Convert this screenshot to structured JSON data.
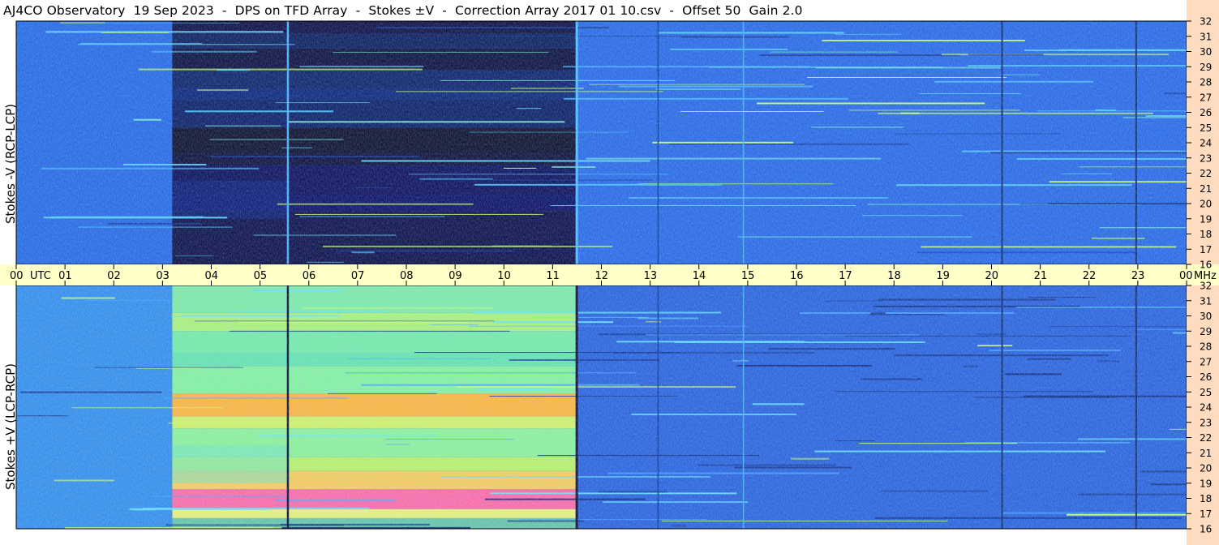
{
  "title": "AJ4CO Observatory  19 Sep 2023  -  DPS on TFD Array  -  Stokes ±V  -  Correction Array 2017 01 10.csv  -  Offset 50  Gain 2.0",
  "colors": {
    "axis_band": "#ffffc8",
    "freq_band": "#ffdcc0",
    "bg": "#ffffff"
  },
  "chart_data": [
    {
      "type": "heatmap",
      "panel": "top",
      "ylabel": "Stokes -V (RCP-LCP)",
      "x_range_utc_hours": [
        0,
        24
      ],
      "y_range_mhz": [
        16,
        32
      ],
      "y_ticks": [
        "16",
        "17",
        "18",
        "19",
        "20",
        "21",
        "22",
        "23",
        "24",
        "25",
        "26",
        "27",
        "28",
        "29",
        "30",
        "31",
        "32"
      ]
    },
    {
      "type": "heatmap",
      "panel": "bottom",
      "ylabel": "Stokes +V (LCP-RCP)",
      "x_range_utc_hours": [
        0,
        24
      ],
      "y_range_mhz": [
        16,
        32
      ],
      "y_ticks": [
        "16",
        "17",
        "18",
        "19",
        "20",
        "21",
        "22",
        "23",
        "24",
        "25",
        "26",
        "27",
        "28",
        "29",
        "30",
        "31",
        "32"
      ]
    }
  ],
  "time_axis": {
    "labels": [
      "00",
      "01",
      "02",
      "03",
      "04",
      "05",
      "06",
      "07",
      "08",
      "09",
      "10",
      "11",
      "12",
      "13",
      "14",
      "15",
      "16",
      "17",
      "18",
      "19",
      "20",
      "21",
      "22",
      "23",
      "00"
    ],
    "utc_label": "UTC",
    "unit_label": "MHz"
  }
}
